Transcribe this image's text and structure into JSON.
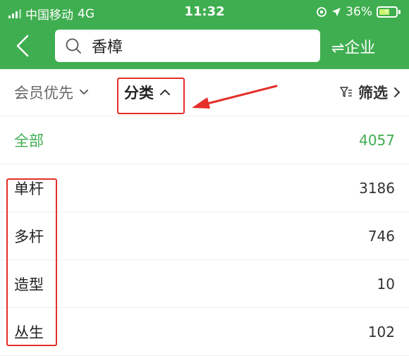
{
  "status_bar": {
    "carrier": "中国移动",
    "network": "4G",
    "time": "11:32",
    "battery": "36%"
  },
  "header": {
    "back_icon": "chevron-left-icon",
    "search_value": "香樟",
    "switch_label": "⇌企业"
  },
  "filters": {
    "member_priority": "会员优先",
    "category": "分类",
    "screen": "筛选"
  },
  "categories": [
    {
      "label": "全部",
      "count": "4057"
    },
    {
      "label": "单杆",
      "count": "3186"
    },
    {
      "label": "多杆",
      "count": "746"
    },
    {
      "label": "造型",
      "count": "10"
    },
    {
      "label": "丛生",
      "count": "102"
    }
  ],
  "colors": {
    "brand_green": "#3fae50",
    "annotation_red": "#e52f2a"
  }
}
